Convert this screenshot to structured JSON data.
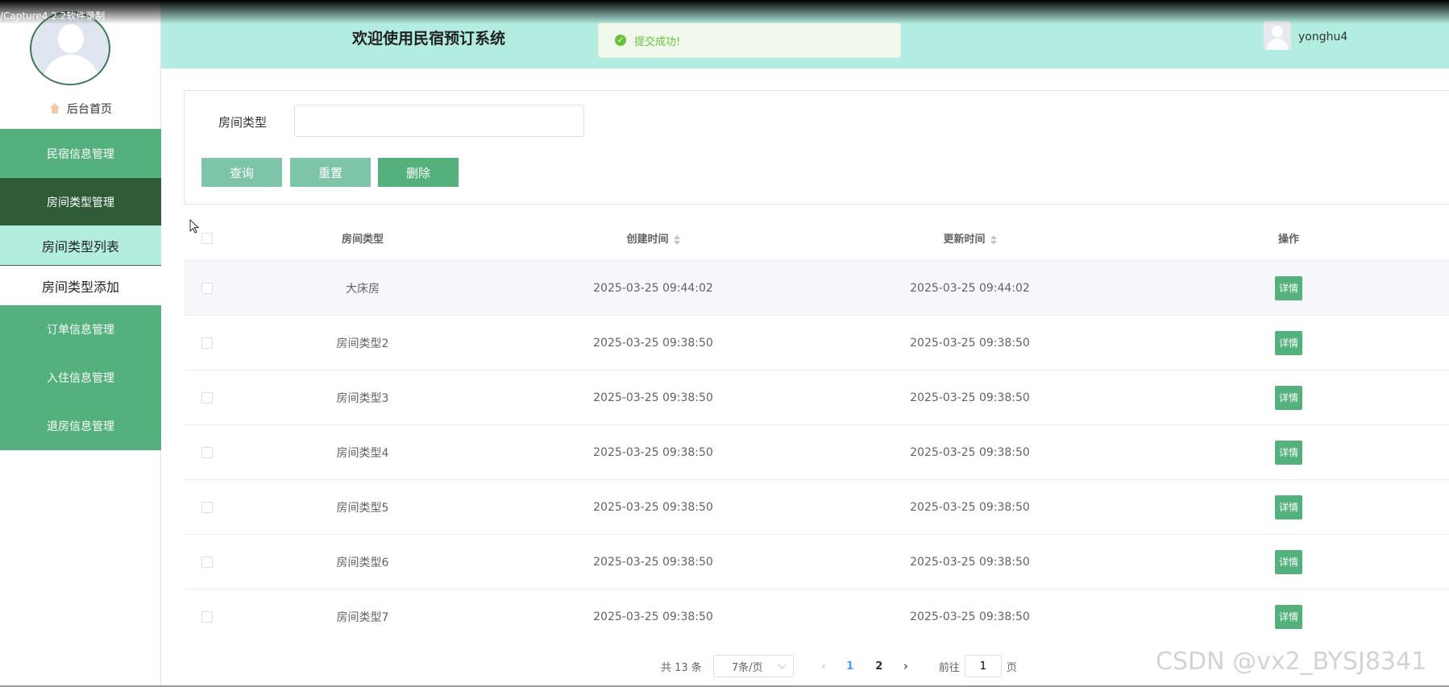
{
  "recorder": {
    "label": "/Capture4.2.2软件录制"
  },
  "sidebar": {
    "home_label": "后台首页",
    "menu": [
      {
        "label": "民宿信息管理"
      },
      {
        "label": "房间类型管理"
      },
      {
        "label": "房间类型列表"
      },
      {
        "label": "房间类型添加"
      },
      {
        "label": "订单信息管理"
      },
      {
        "label": "入住信息管理"
      },
      {
        "label": "退房信息管理"
      }
    ]
  },
  "header": {
    "title": "欢迎使用民宿预订系统",
    "toast": "提交成功!",
    "username": "yonghu4"
  },
  "search": {
    "label": "房间类型",
    "value": "",
    "buttons": {
      "query": "查询",
      "reset": "重置",
      "delete": "删除"
    }
  },
  "table": {
    "columns": {
      "type": "房间类型",
      "created": "创建时间",
      "updated": "更新时间",
      "op": "操作"
    },
    "rows": [
      {
        "type": "大床房",
        "created": "2025-03-25 09:44:02",
        "updated": "2025-03-25 09:44:02",
        "action": "详情"
      },
      {
        "type": "房间类型2",
        "created": "2025-03-25 09:38:50",
        "updated": "2025-03-25 09:38:50",
        "action": "详情"
      },
      {
        "type": "房间类型3",
        "created": "2025-03-25 09:38:50",
        "updated": "2025-03-25 09:38:50",
        "action": "详情"
      },
      {
        "type": "房间类型4",
        "created": "2025-03-25 09:38:50",
        "updated": "2025-03-25 09:38:50",
        "action": "详情"
      },
      {
        "type": "房间类型5",
        "created": "2025-03-25 09:38:50",
        "updated": "2025-03-25 09:38:50",
        "action": "详情"
      },
      {
        "type": "房间类型6",
        "created": "2025-03-25 09:38:50",
        "updated": "2025-03-25 09:38:50",
        "action": "详情"
      },
      {
        "type": "房间类型7",
        "created": "2025-03-25 09:38:50",
        "updated": "2025-03-25 09:38:50",
        "action": "详情"
      }
    ]
  },
  "pagination": {
    "total": "共 13 条",
    "page_size": "7条/页",
    "pages": [
      "1",
      "2"
    ],
    "current": "1",
    "goto_prefix": "前往",
    "goto_value": "1",
    "goto_suffix": "页"
  },
  "watermark": "CSDN @vx2_BYSJ8341",
  "colors": {
    "primary": "#54b07c",
    "header_bg": "#b3ede2",
    "dark_menu": "#2f5c37"
  }
}
